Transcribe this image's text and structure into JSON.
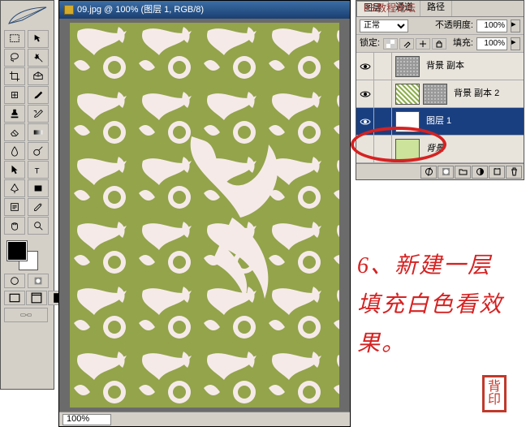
{
  "document": {
    "title": "09.jpg @ 100% (图层 1, RGB/8)",
    "zoom": "100%"
  },
  "panel": {
    "tabs": {
      "layers": "图层",
      "channels": "通道",
      "paths": "路径"
    },
    "blend_mode": "正常",
    "opacity_label": "不透明度:",
    "opacity_value": "100%",
    "lock_label": "锁定:",
    "fill_label": "填充:",
    "fill_value": "100%",
    "layers": [
      {
        "name": "背景 副本",
        "visible": true,
        "thumb": "pattern",
        "selected": false
      },
      {
        "name": "背景 副本 2",
        "visible": true,
        "thumb": "pattern",
        "mask": "green",
        "selected": false
      },
      {
        "name": "图层 1",
        "visible": true,
        "thumb": "white",
        "selected": true
      },
      {
        "name": "背景",
        "visible": false,
        "thumb": "lightgreen",
        "selected": false,
        "locked": true
      }
    ]
  },
  "annotation": {
    "instruction_line1": "6、新建一层",
    "instruction_line2": "填充白色看效",
    "instruction_line3": "果。",
    "watermark": "PS教程论坛"
  }
}
